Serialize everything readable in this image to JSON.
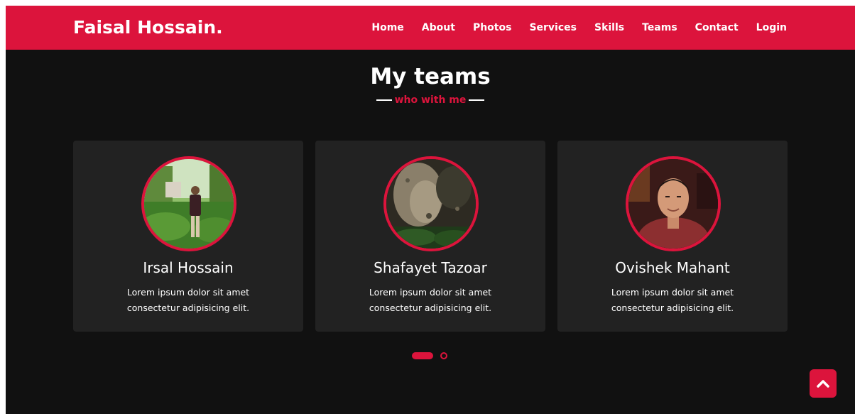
{
  "navbar": {
    "brand": "Faisal Hossain.",
    "items": [
      {
        "label": "Home"
      },
      {
        "label": "About"
      },
      {
        "label": "Photos"
      },
      {
        "label": "Services"
      },
      {
        "label": "Skills"
      },
      {
        "label": "Teams"
      },
      {
        "label": "Contact"
      },
      {
        "label": "Login"
      }
    ]
  },
  "section": {
    "title": "My teams",
    "subtitle": "who with me"
  },
  "team": [
    {
      "name": "Irsal Hossain",
      "description": "Lorem ipsum dolor sit amet consectetur adipisicing elit."
    },
    {
      "name": "Shafayet Tazoar",
      "description": "Lorem ipsum dolor sit amet consectetur adipisicing elit."
    },
    {
      "name": "Ovishek Mahant",
      "description": "Lorem ipsum dolor sit amet consectetur adipisicing elit."
    }
  ],
  "carousel": {
    "active_page": 1,
    "page_count": 2
  },
  "icons": {
    "scroll_top": "chevron-up-icon"
  },
  "colors": {
    "accent": "#dc143c",
    "background": "#111111",
    "card": "#222222",
    "text": "#ffffff"
  }
}
